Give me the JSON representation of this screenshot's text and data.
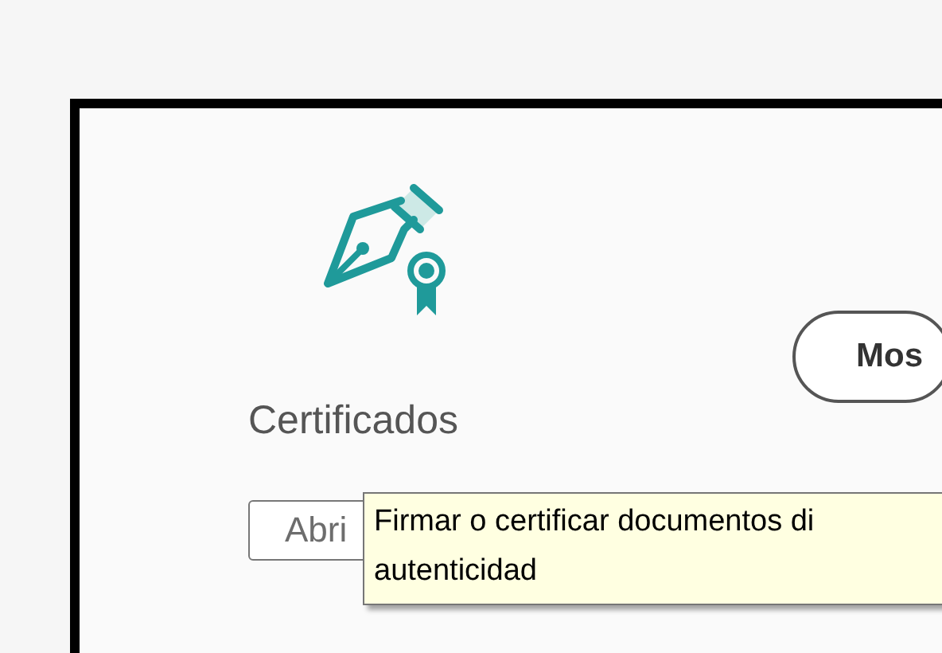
{
  "card": {
    "title": "Certificados",
    "open_button": "Abri",
    "show_button": "Mos"
  },
  "tooltip": {
    "lines": [
      "Firmar o certificar documentos di",
      "autenticidad"
    ]
  }
}
